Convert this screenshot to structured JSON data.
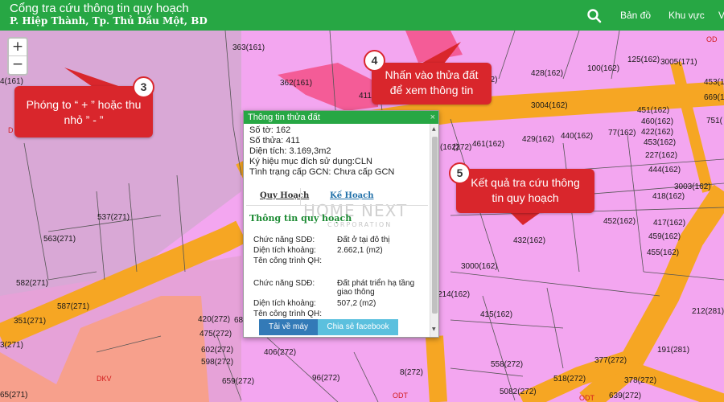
{
  "header": {
    "title": "Cổng tra cứu thông tin quy hoạch",
    "subtitle": "P. Hiệp Thành, Tp. Thủ Dầu Một, BD",
    "nav": [
      "Bản đồ",
      "Khu vực",
      "V"
    ],
    "search_icon": "search-icon",
    "bar_color": "#27a744"
  },
  "zoom": {
    "in_label": "+",
    "out_label": "−"
  },
  "callouts": {
    "c3": {
      "number": "3",
      "text": "Phóng to “ + ” hoặc thu nhỏ ” - ”"
    },
    "c4": {
      "number": "4",
      "text": "Nhấn vào thửa đất để xem thông tin"
    },
    "c5": {
      "number": "5",
      "text": "Kết quả tra cứu thông tin quy hoạch"
    },
    "color": "#d9262c"
  },
  "map": {
    "parcels": [
      "363(161)",
      "4(161)",
      "362(161)",
      "125(162)",
      "3005(171)",
      "428(162)",
      "100(162)",
      "453(1",
      "669(1",
      "3004(162)",
      "451(162)",
      "460(162)",
      "751(",
      "77(162)",
      "422(162)",
      "453(162)",
      "227(162)",
      "461(162)",
      "429(162)",
      "440(162)",
      "(162)",
      "444(162)",
      "3003(162)",
      "418(162)",
      "537(271)",
      "563(271)",
      "452(162)",
      "417(162)",
      "459(162)",
      "432(162)",
      "455(162)",
      "582(271)",
      "587(271)",
      "3000(162)",
      "351(271)",
      "214(162)",
      "415(162)",
      "212(281)",
      "420(272)",
      "475(272)",
      "3(271)",
      "602(272)",
      "598(272)",
      "406(272)",
      "96(272)",
      "8(272)",
      "558(272)",
      "377(272)",
      "191(281)",
      "659(272)",
      "518(272)",
      "378(272)",
      "5082(272)",
      "639(272)",
      "65(271)",
      "411",
      "62)",
      "68",
      "(272)"
    ],
    "zones": [
      "D",
      "DKV",
      "ODT",
      "ODT",
      "OD"
    ]
  },
  "popup": {
    "title": "Thông tin thửa đất",
    "close": "×",
    "so_to": "Số tờ: 162",
    "so_thua": "Số thửa: 411",
    "dien_tich": "Diện tích: 3.169,3m2",
    "ky_hieu": "Ký hiệu mục đích sử dụng:CLN",
    "tinh_trang": "Tình trạng cấp GCN: Chưa cấp GCN",
    "tabs": [
      "Quy Hoạch",
      "Kế Hoạch"
    ],
    "section_title": "Thông tin quy hoạch",
    "groups": [
      {
        "rows": [
          {
            "label": "Chức năng SDĐ:",
            "value": "Đất ở tại đô thị"
          },
          {
            "label": "Diện tích khoảng:",
            "value": "2.662,1 (m2)"
          },
          {
            "label": "Tên công trình QH:",
            "value": ""
          }
        ]
      },
      {
        "rows": [
          {
            "label": "Chức năng SDĐ:",
            "value": "Đất phát triển hạ tầng giao thông"
          },
          {
            "label": "Diện tích khoảng:",
            "value": "507,2 (m2)"
          },
          {
            "label": "Tên công trình QH:",
            "value": ""
          }
        ]
      }
    ],
    "buttons": {
      "download": "Tải về máy",
      "share": "Chia sẻ facebook"
    },
    "watermark": "HOME NEXT",
    "watermark_sub": "CORPORATION"
  }
}
